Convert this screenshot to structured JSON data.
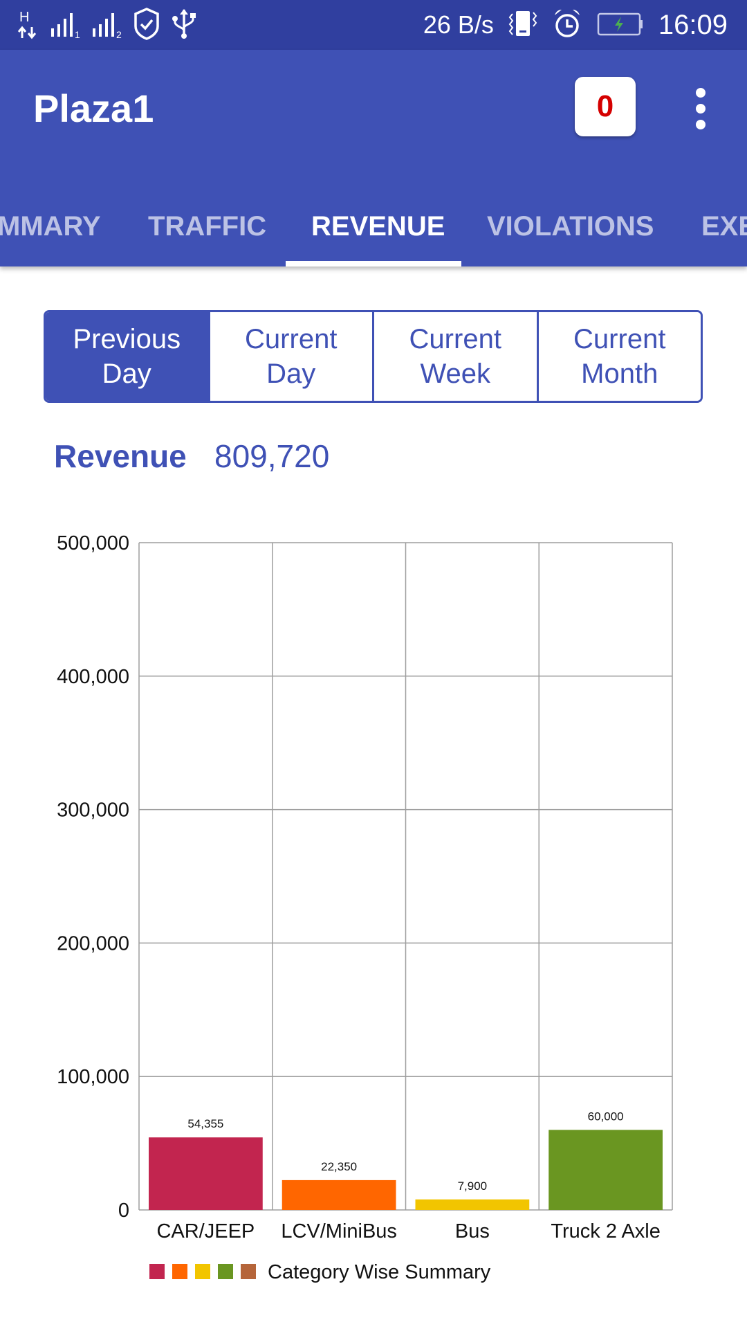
{
  "status_bar": {
    "left_icons": [
      "hspa-data-icon",
      "signal-sim1-icon",
      "signal-sim2-icon",
      "shield-check-icon",
      "usb-icon"
    ],
    "net_speed": "26 B/s",
    "right_icons": [
      "vibrate-icon",
      "alarm-icon",
      "battery-charging-icon"
    ],
    "time": "16:09",
    "sim1_label": "1",
    "sim2_label": "2",
    "hspa_label": "H"
  },
  "app_bar": {
    "title": "Plaza1",
    "badge_count": "0",
    "badge_color": "#D50000",
    "overflow_icon": "more-vert-icon",
    "brand_color": "#3F51B5",
    "status_color": "#303F9F"
  },
  "tabs": [
    {
      "label": "SUMMARY",
      "visible_text": "MMARY",
      "active": false
    },
    {
      "label": "TRAFFIC",
      "visible_text": "TRAFFIC",
      "active": false
    },
    {
      "label": "REVENUE",
      "visible_text": "REVENUE",
      "active": true
    },
    {
      "label": "VIOLATIONS",
      "visible_text": "VIOLATIONS",
      "active": false
    },
    {
      "label": "EXEMPT",
      "visible_text": "EXE",
      "active": false
    }
  ],
  "period_selector": [
    {
      "line1": "Previous",
      "line2": "Day",
      "active": true
    },
    {
      "line1": "Current",
      "line2": "Day",
      "active": false
    },
    {
      "line1": "Current",
      "line2": "Week",
      "active": false
    },
    {
      "line1": "Current",
      "line2": "Month",
      "active": false
    }
  ],
  "revenue": {
    "label": "Revenue",
    "value": "809,720"
  },
  "chart_data": {
    "type": "bar",
    "title": "",
    "xlabel": "",
    "ylabel": "",
    "categories": [
      "CAR/JEEP",
      "LCV/MiniBus",
      "Bus",
      "Truck 2 Axle"
    ],
    "values": [
      54355,
      22350,
      7900,
      60000
    ],
    "value_labels": [
      "54,355",
      "22,350",
      "7,900",
      "60,000"
    ],
    "colors": [
      "#C2254F",
      "#FF6600",
      "#F2C500",
      "#6A9621"
    ],
    "ylim": [
      0,
      500000
    ],
    "yticks": [
      0,
      100000,
      200000,
      300000,
      400000,
      500000
    ],
    "ytick_labels": [
      "0",
      "100,000",
      "200,000",
      "300,000",
      "400,000",
      "500,000"
    ],
    "grid": true,
    "legend": {
      "placement": "bottom-left",
      "label": "Category Wise Summary",
      "swatches": [
        "#C2254F",
        "#FF6600",
        "#F2C500",
        "#6A9621",
        "#B5653A"
      ]
    }
  }
}
